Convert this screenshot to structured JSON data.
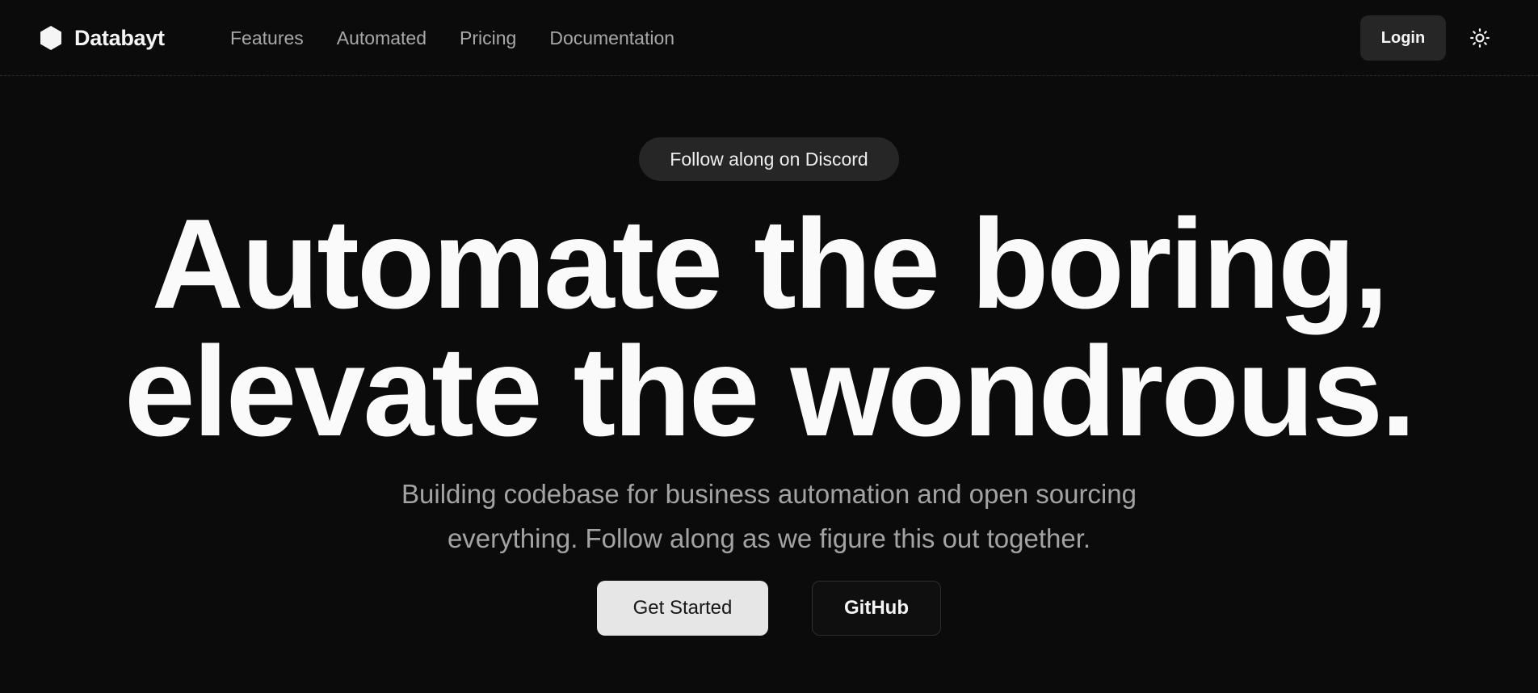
{
  "header": {
    "brand": {
      "name": "Databayt",
      "logo_icon": "hexagon-logo-icon"
    },
    "nav": [
      {
        "label": "Features"
      },
      {
        "label": "Automated"
      },
      {
        "label": "Pricing"
      },
      {
        "label": "Documentation"
      }
    ],
    "login_label": "Login",
    "theme_toggle_icon": "sun-icon"
  },
  "hero": {
    "badge": "Follow along on Discord",
    "title_line1": "Automate the boring,",
    "title_line2": "elevate the wondrous.",
    "subtitle": "Building codebase for business automation and open sourcing everything. Follow along as we figure this out together.",
    "primary_button": "Get Started",
    "secondary_button": "GitHub"
  },
  "colors": {
    "background": "#0b0b0b",
    "foreground": "#fafafa",
    "muted_text": "#a3a3a3",
    "surface": "#262626",
    "primary_button_bg": "#e6e6e6"
  }
}
